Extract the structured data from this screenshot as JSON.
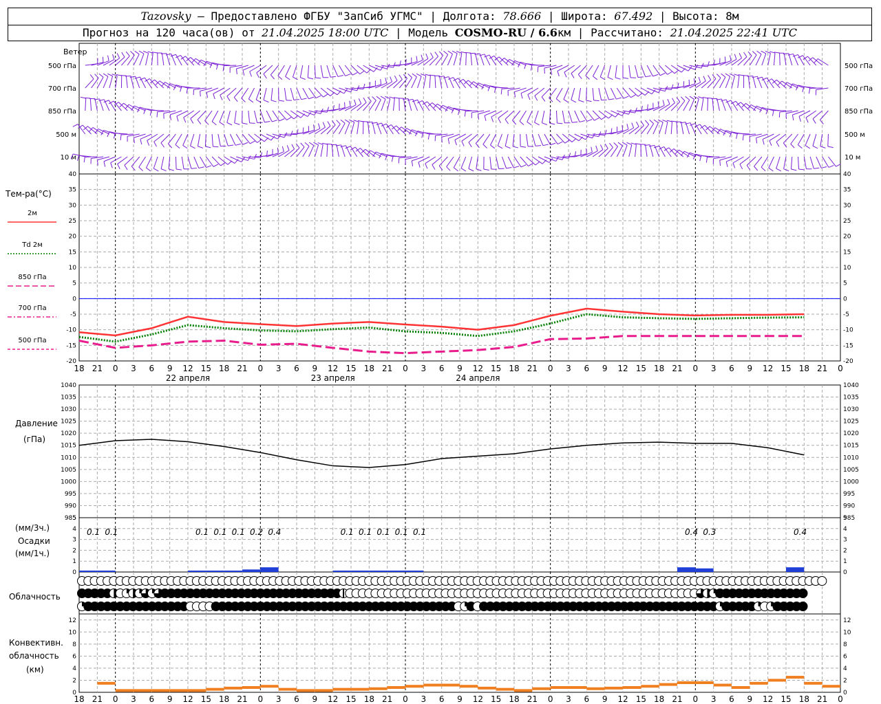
{
  "header": {
    "station": "Tazovsky",
    "provider": "— Предоставлено ФГБУ \"ЗапСиб УГМС\"",
    "lon_label": "Долгота:",
    "lon": "78.666",
    "lat_label": "Широта:",
    "lat": "67.492",
    "alt_label": "Высота: 8м",
    "forecast_prefix": "Прогноз на 120 часа(ов) от",
    "forecast_time": "21.04.2025 18:00 UTC",
    "model_label": "Модель",
    "model": "COSMO-RU / 6.6",
    "model_unit": "км",
    "calc_label": "Рассчитано:",
    "calc_time": "21.04.2025 22:41 UTC"
  },
  "colors": {
    "wind": "#7b1fd6",
    "t2m": "#ff3333",
    "td2m": "#008000",
    "t850": "#e81c8c",
    "t700": "#e81c8c",
    "t500": "#e81c8c",
    "zero": "#0000ff",
    "pressure": "#000000",
    "precip": "#1f3fd6",
    "conv": "#f07f1f"
  },
  "chart_data": [
    {
      "type": "wind_barbs",
      "title": "Ветер",
      "levels": [
        "500 гПа",
        "700 гПа",
        "850 гПа",
        "500 м",
        "10 м"
      ]
    },
    {
      "type": "line",
      "ylabel": "Тем-ра(°C)",
      "ylim": [
        -20,
        40
      ],
      "yticks": [
        40,
        35,
        30,
        25,
        20,
        15,
        10,
        5,
        0,
        -5,
        -10,
        -15,
        -20
      ],
      "x_hours": [
        0,
        6,
        12,
        18,
        24,
        30,
        36,
        42,
        48,
        54,
        60,
        66,
        72,
        78,
        84,
        90,
        96,
        102,
        108,
        114,
        120
      ],
      "series": [
        {
          "name": "2м",
          "style": "solid",
          "values": [
            -10.8,
            -11.8,
            -9.5,
            -5.8,
            -7.5,
            -8.2,
            -8.8,
            -8.0,
            -7.5,
            -8.3,
            -9.0,
            -10.0,
            -8.5,
            -5.5,
            -3.2,
            -4.2,
            -5.0,
            -5.4,
            -5.2,
            -5.2,
            -5.0
          ]
        },
        {
          "name": "Td 2м",
          "style": "dotted",
          "values": [
            -12.3,
            -13.8,
            -11.5,
            -8.5,
            -9.5,
            -10.2,
            -10.5,
            -9.8,
            -9.3,
            -10.5,
            -11.0,
            -12.0,
            -10.5,
            -8.0,
            -5.0,
            -6.0,
            -6.3,
            -6.5,
            -6.3,
            -6.1,
            -6.0
          ]
        },
        {
          "name": "850 гПа",
          "style": "dashed",
          "values": [
            -13.5,
            -15.8,
            -15.0,
            -13.8,
            -13.5,
            -14.8,
            -14.5,
            -15.8,
            -17.0,
            -17.5,
            -17.0,
            -16.5,
            -15.5,
            -13.0,
            -12.8,
            -12.0,
            -12.0,
            -12.0,
            -12.0,
            -12.0,
            -12.0
          ]
        },
        {
          "name": "700 гПа",
          "style": "dashdot",
          "values": []
        },
        {
          "name": "500 гПа",
          "style": "dash-short",
          "values": []
        }
      ],
      "x_day_labels": [
        "22 апреля",
        "23 апреля",
        "24 апреля"
      ]
    },
    {
      "type": "line",
      "ylabel": "Давление",
      "yunit": "(гПа)",
      "ylim": [
        985,
        1040
      ],
      "yticks": [
        1040,
        1035,
        1030,
        1025,
        1020,
        1015,
        1010,
        1005,
        1000,
        995,
        990,
        985
      ],
      "series": [
        {
          "name": "pressure",
          "values": [
            1015,
            1016.9,
            1017.5,
            1016.5,
            1014.5,
            1012,
            1009,
            1006.5,
            1005.8,
            1007,
            1009.5,
            1010.5,
            1011.5,
            1013.5,
            1015,
            1016,
            1016.3,
            1015.8,
            1015.8,
            1014,
            1011
          ]
        }
      ]
    },
    {
      "type": "bar",
      "ylabel_top": "(мм/3ч.)",
      "ylabel_mid": "Осадки",
      "ylabel_bot": "(мм/1ч.)",
      "ylim": [
        0,
        5
      ],
      "yticks": [
        5,
        4,
        3,
        2,
        1,
        0
      ],
      "labels": [
        {
          "x": 2,
          "text": "0.1"
        },
        {
          "x": 5,
          "text": "0.1"
        },
        {
          "x": 20,
          "text": "0.1"
        },
        {
          "x": 23,
          "text": "0.1"
        },
        {
          "x": 26,
          "text": "0.1"
        },
        {
          "x": 29,
          "text": "0.2"
        },
        {
          "x": 32,
          "text": "0.4"
        },
        {
          "x": 44,
          "text": "0.1"
        },
        {
          "x": 47,
          "text": "0.1"
        },
        {
          "x": 50,
          "text": "0.1"
        },
        {
          "x": 53,
          "text": "0.1"
        },
        {
          "x": 56,
          "text": "0.1"
        },
        {
          "x": 101,
          "text": "0.4"
        },
        {
          "x": 104,
          "text": "0.3"
        },
        {
          "x": 119,
          "text": "0.4"
        }
      ]
    },
    {
      "type": "cloud_symbols",
      "ylabel": "Облачность",
      "rows": [
        "000000000000000000000000000000000000000000000000000000000000000000000000000000000000000000000000000000000000000000000",
        "444442012131344444444444444444444444444445000000000000000000000000000000000000000000000000000000032144444444444444",
        "144444444444444440000444444444444444444444444444444444444440140444444444444444444444444444444444444414444410144444"
      ]
    },
    {
      "type": "bar",
      "ylabel": "Конвективн.",
      "ylabel2": "облачность",
      "ylabel3": "(км)",
      "ylim": [
        0,
        13
      ],
      "yticks": [
        12,
        10,
        8,
        6,
        4,
        2,
        0
      ]
    }
  ],
  "x_tick_labels": [
    "18",
    "21",
    "0",
    "3",
    "6",
    "9",
    "12",
    "15",
    "18",
    "21",
    "0",
    "3",
    "6",
    "9",
    "12",
    "15",
    "18",
    "21",
    "0",
    "3",
    "6",
    "9",
    "12",
    "15",
    "18",
    "21",
    "0",
    "3",
    "6",
    "9",
    "12",
    "15",
    "18",
    "21",
    "0",
    "3",
    "6",
    "9",
    "12",
    "15",
    "18",
    "21",
    "0"
  ]
}
